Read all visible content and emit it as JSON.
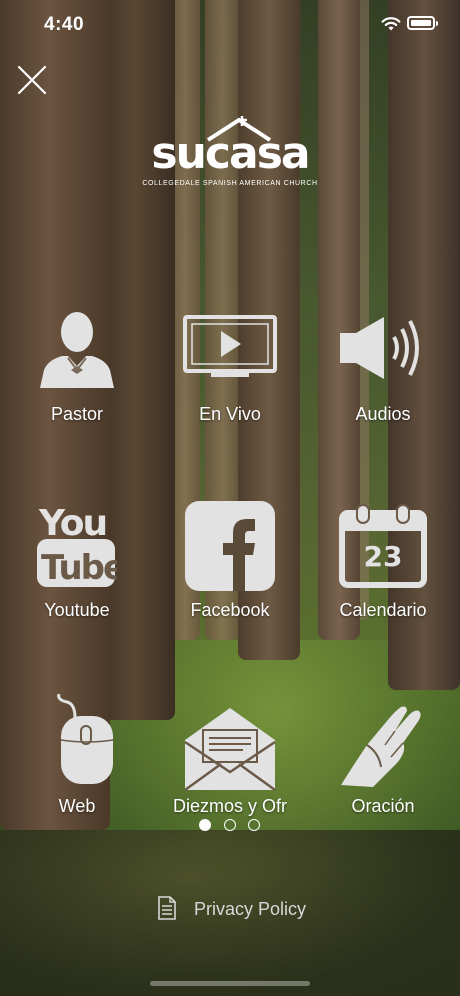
{
  "status_bar": {
    "time": "4:40"
  },
  "logo": {
    "wordmark": "sucasa",
    "subtitle": "COLLEGEDALE SPANISH AMERICAN CHURCH"
  },
  "menu": {
    "items": [
      {
        "label": "Pastor",
        "icon": "pastor-icon"
      },
      {
        "label": "En Vivo",
        "icon": "tv-play-icon"
      },
      {
        "label": "Audios",
        "icon": "speaker-icon"
      },
      {
        "label": "Youtube",
        "icon": "youtube-icon"
      },
      {
        "label": "Facebook",
        "icon": "facebook-icon"
      },
      {
        "label": "Calendario",
        "icon": "calendar-icon",
        "badge": "23"
      },
      {
        "label": "Web",
        "icon": "mouse-icon"
      },
      {
        "label": "Diezmos y Ofr",
        "icon": "envelope-icon"
      },
      {
        "label": "Oración",
        "icon": "praying-hands-icon"
      }
    ]
  },
  "pager": {
    "pages": 3,
    "current": 1
  },
  "footer": {
    "privacy_label": "Privacy Policy"
  },
  "colors": {
    "icon": "#e8e8e8",
    "text": "#ffffff"
  }
}
